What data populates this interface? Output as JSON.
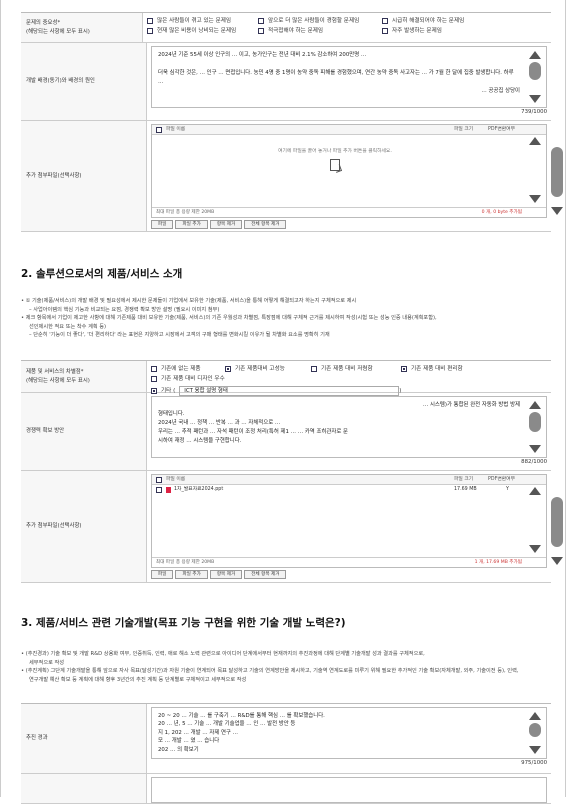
{
  "problem_importance": {
    "label": "문제의 중요성*",
    "sublabel": "(해당되는 사항에 모두 표시)",
    "options": [
      {
        "label": "많은 사람들이 겪고 있는 문제임",
        "checked": false
      },
      {
        "label": "앞으로 더 많은 사람들이 경험할 문제임",
        "checked": false
      },
      {
        "label": "시급히 해결되어야 하는 문제임",
        "checked": false
      },
      {
        "label": "현재 많은 비용이 낭비되는 문제임",
        "checked": false
      },
      {
        "label": "적극접해야 하는 문제임",
        "checked": false
      },
      {
        "label": "자주 발생하는 문제임",
        "checked": false
      }
    ]
  },
  "background": {
    "label": "개발 배경(동기)와 배경의 원인",
    "line1": "2024년 기준 55세 이상 인구의 … 이고, 농가인구는 전년 대비 2.1% 감소하여 200만명 … ",
    "line2": "더욱 심각한 것은, … 인구 … 면접입니다. 농민 4명 중 1명이 농약 중독 피해를 경험했으며, 연간 농약 중독 사고자는 … 가 7월 한 달에 집중 발생합니다. 하루 …",
    "line2b": "… 공공집 상당이",
    "counter": "739/1000"
  },
  "attach1": {
    "label": "추가 첨부파일(선택사항)",
    "col_name": "파일 이름",
    "col_size": "파일 크기",
    "col_pdf": "PDF변환여부",
    "empty_text": "여기에 파일을 끌어 놓거나 파일 추가 버튼을 클릭하세요.",
    "foot_left": "최대 파일 총 용량 제한 20MB",
    "foot_right": "0 개, 0 byte 추가됨",
    "buttons": [
      "파일",
      "파일 추가",
      "항목 제거",
      "전체 항목 제거"
    ]
  },
  "section2": {
    "title": "2. 솔루션으로서의 제품/서비스 소개",
    "note1": "• ① 기술(제품/서비스)의 개발 배경 및 필요성에서 제시한 문제들이 기업에서 보유한 기술(제품, 서비스)을 통해 어떻게 해결되고자 하는지 구체적으로 제시",
    "note1a": "– 사업아이템의 핵심 기능과 비교되는 요점, 경쟁력 확보 방안 설명 (필요시 이미지 첨부)",
    "note2": "• 제크 항목에서 기업이 제고한 사항에 대해 기존제품 대비 보유한 기술(제품, 서비스)의 기존 우월성과 차별점, 특장점에 대해 구체적 근거를 제시하여 작성(시험 또는 성능 인증 내용(계획포함),",
    "note2a": "선인제시한 적요 또는 착수 계획 등)",
    "note3": "– 단순히 '기능이 더 좋다', '더 편리하다' 라는 표현은 지양하고 시장에서 고객의 구매 형태를 변화시킬 이유가 될 차별화 요소를 명확히 기재"
  },
  "differentiation": {
    "label": "제품 및 서비스의 차별점*",
    "sublabel": "(해당되는 사항에 모두 표시)",
    "options": [
      {
        "label": "기존에 없는 제품",
        "checked": false
      },
      {
        "label": "기존 제품대비 고성능",
        "checked": true
      },
      {
        "label": "기존 제품 대비 저렴함",
        "checked": false
      },
      {
        "label": "기존 제품 대비 편리함",
        "checked": true
      },
      {
        "label": "기존 제품 대비 디자인 우수",
        "checked": false
      }
    ],
    "other_label": "기타 (",
    "other_checked": true,
    "other_value": "ICT 융합 설명 형태",
    "other_close": ")"
  },
  "competitive": {
    "label": "경쟁력 확보 방안",
    "line1": "… 시스템)가 통합된 완전 자동화 방법 방제",
    "line2": "형태입니다.",
    "line3": "2024년 국내 … 정책 … 반복 … 과 … 자체적으로 …",
    "line4": "우리는 … 추적 패턴과 … 자석 패턴이 조정 처리(특허 제1 … … 카역 조히관자로 문",
    "line5": "시하여 재정 … 시스템을 구현합니다.",
    "counter": "882/1000"
  },
  "attach2": {
    "label": "추가 첨부파일(선택사항)",
    "col_name": "파일 이름",
    "col_size": "파일 크기",
    "col_pdf": "PDF변환여부",
    "file_name": "1차_발표자료2024.ppt",
    "file_size": "17.69 MB",
    "file_pdf": "Y",
    "foot_left": "최대 파일 총 용량 제한 20MB",
    "foot_right": "1 개, 17.69 MB 추가됨",
    "buttons": [
      "파일",
      "파일 추가",
      "항목 제거",
      "전체 항목 제거"
    ]
  },
  "section3": {
    "title": "3. 제품/서비스 관련 기술개발(목표 기능 구현을 위한 기술 개발 노력은?)",
    "note1": "• (추진경과) 기술 확보 및 개발 R&D 상용화 여부, 인증취득, 인력, 애로 해소 노력 관련으로 아이디어 단계에서부터 현재까지의 추진과정에 대해 단계별 기술개발 성과 결과를 구체적으로,",
    "note1a": "세부적으로 작성",
    "note2": "• (추진계획) 그단계 기술개발을 통해 앞으로 자사 목표(달성기간)과 자원 기술이 연계되어 목표 달성하고 기술의 연계방안을 제시하고, 기술역 연계도로를 미루기 위해 필요한 추가적인 기술 확보(자체개발, 외주, 기술이전 등), 인력,",
    "note2a": "연구개발 예산 확보 등 계획에 대해 향후 3년간의 추진 계획 등 단계별로 구체적이고 세부적으로 작성"
  },
  "progress": {
    "label": "추진 경과",
    "line1": "20 ~ 20 … 기술 … 를 구축기 … R&D를 통해 핵심 … 를 확보했습니다.",
    "line2": "20 … 년, 5 … 기술 … 개발 기술업을 … 인 … 발전 방안 등",
    "line3": "지 1, 202 … 개발 … 자제 연구 …",
    "line4": "모 … 개발 … 였 … 습니다",
    "line5": "202 … 의 확보기",
    "counter": "975/1000"
  }
}
